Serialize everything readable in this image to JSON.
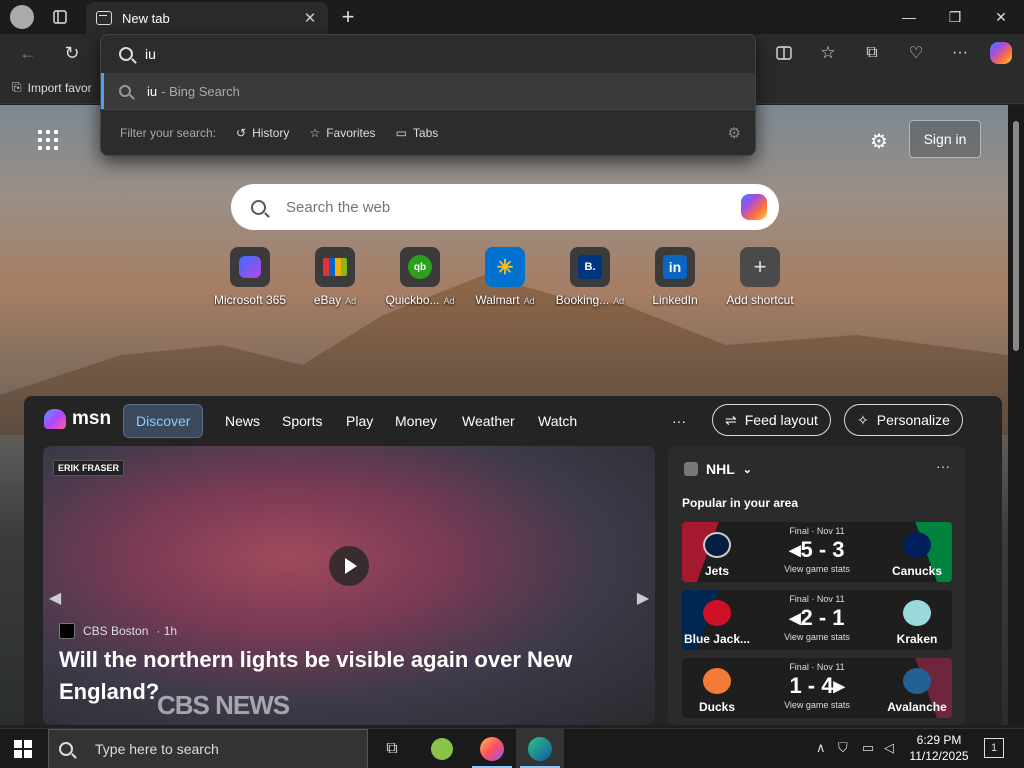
{
  "browser": {
    "tab_title": "New tab",
    "new_tab_symbol": "+",
    "close_symbol": "✕",
    "favorites_import": "Import favor"
  },
  "omnibox": {
    "query": "iu",
    "suggestion_query": "iu",
    "suggestion_source": "- Bing Search",
    "filter_label": "Filter your search:",
    "filters": [
      "History",
      "Favorites",
      "Tabs"
    ]
  },
  "page": {
    "signin": "Sign in",
    "search_placeholder": "Search the web",
    "shortcuts": [
      {
        "label": "Microsoft 365",
        "ad": "",
        "icon": "M",
        "color": "#5b3fb5"
      },
      {
        "label": "eBay",
        "ad": "Ad",
        "icon": "e",
        "color": "#3a3a3a"
      },
      {
        "label": "Quickbo...",
        "ad": "Ad",
        "icon": "qb",
        "color": "#2ca01c"
      },
      {
        "label": "Walmart",
        "ad": "Ad",
        "icon": "✳",
        "color": "#0071ce"
      },
      {
        "label": "Booking...",
        "ad": "Ad",
        "icon": "B.",
        "color": "#003580"
      },
      {
        "label": "LinkedIn",
        "ad": "",
        "icon": "in",
        "color": "#0a66c2"
      },
      {
        "label": "Add shortcut",
        "ad": "",
        "icon": "+",
        "color": "#444444"
      }
    ]
  },
  "msn": {
    "logo": "msn",
    "nav": [
      "Discover",
      "News",
      "Sports",
      "Play",
      "Money",
      "Weather",
      "Watch"
    ],
    "more": "···",
    "feed_layout": "Feed layout",
    "personalize": "Personalize"
  },
  "hero": {
    "badge": "ERIK FRASER",
    "source": "CBS Boston",
    "age": "· 1h",
    "title": "Will the northern lights be visible again over New England?",
    "watermark": "CBS NEWS"
  },
  "nhl": {
    "title": "NHL",
    "subtitle": "Popular in your area",
    "games": [
      {
        "status": "Final · Nov 11",
        "score": "◂5 - 3",
        "stats": "View game stats",
        "home": "Jets",
        "away": "Canucks",
        "home_color": "#a6192e",
        "away_color": "#00843d"
      },
      {
        "status": "Final · Nov 11",
        "score": "◂2 - 1",
        "stats": "View game stats",
        "home": "Blue Jack...",
        "away": "Kraken",
        "home_color": "#002654",
        "away_color": "#001628"
      },
      {
        "status": "Final · Nov 11",
        "score": "1 - 4▸",
        "stats": "View game stats",
        "home": "Ducks",
        "away": "Avalanche",
        "home_color": "#111111",
        "away_color": "#6f263d"
      }
    ]
  },
  "taskbar": {
    "search_placeholder": "Type here to search",
    "time": "6:29 PM",
    "date": "11/12/2025",
    "notifications": "1"
  }
}
